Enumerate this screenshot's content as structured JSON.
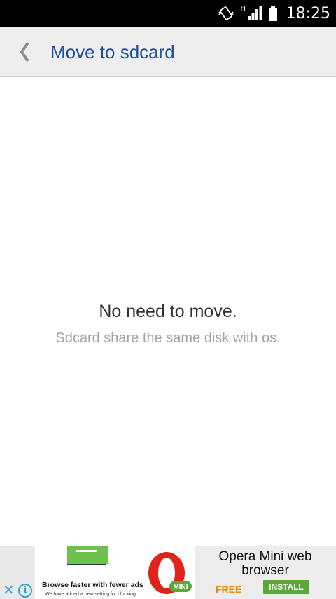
{
  "status_bar": {
    "time": "18:25",
    "network_type": "H",
    "icons": [
      "vibrate-icon",
      "signal-icon",
      "battery-icon"
    ]
  },
  "app_bar": {
    "back_icon": "chevron-left-icon",
    "title": "Move to sdcard"
  },
  "message": {
    "heading": "No need to move.",
    "detail": "Sdcard share the same disk with os."
  },
  "ad_banner": {
    "headline": "Browse faster with fewer ads",
    "note": "We have added a new setting for blocking",
    "logo_text": "MINI",
    "app_name": "Opera Mini web browser",
    "price": "FREE",
    "cta": "INSTALL",
    "close_glyph": "✕",
    "info_glyph": "i",
    "colors": {
      "accent": "#32a2cf",
      "install": "#5aa83a",
      "free": "#f08a00",
      "opera_red": "#e0241b"
    }
  }
}
